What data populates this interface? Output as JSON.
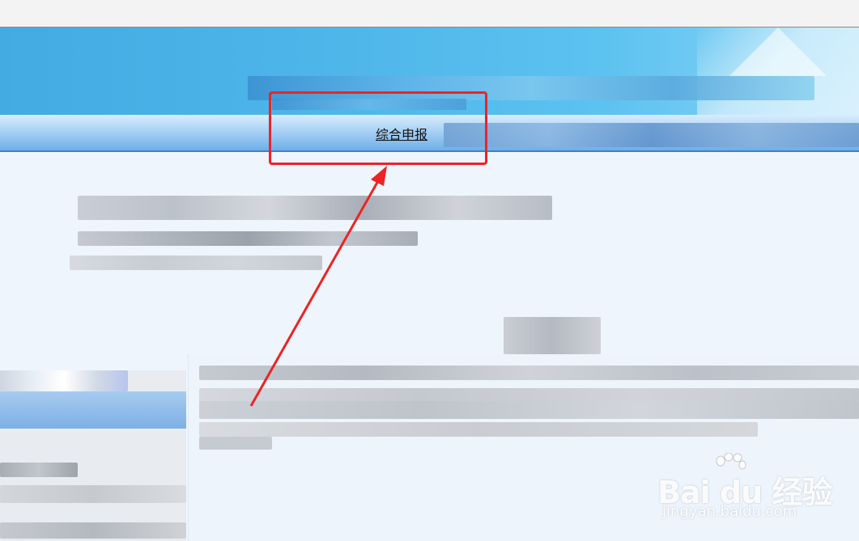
{
  "nav": {
    "link_label": "综合申报"
  },
  "watermark": {
    "logo_text": "Bai du 经验",
    "sub_text": "jingyan.baidu.com"
  },
  "colors": {
    "banner_blue": "#43abe2",
    "nav_blue": "#6eaee9",
    "highlight_red": "#ee2323",
    "background": "#eef5fd"
  },
  "icons": {
    "watermark_logo": "baidu-paw-icon"
  }
}
